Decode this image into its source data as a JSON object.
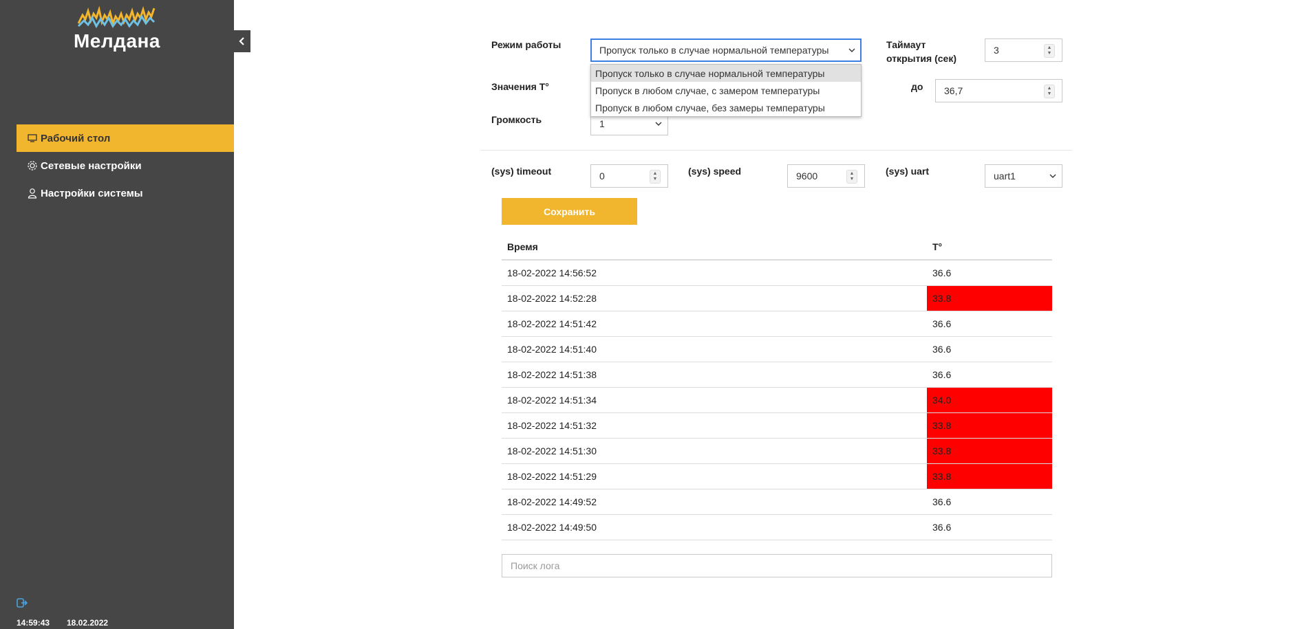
{
  "brand": {
    "name": "Мелдана"
  },
  "sidebar": {
    "items": [
      {
        "label": "Рабочий стол",
        "icon": "monitor-icon",
        "active": true
      },
      {
        "label": "Сетевые настройки",
        "icon": "gear-icon",
        "active": false
      },
      {
        "label": "Настройки системы",
        "icon": "user-icon",
        "active": false
      }
    ],
    "footer": {
      "time": "14:59:43",
      "date": "18.02.2022"
    }
  },
  "settings": {
    "mode": {
      "label": "Режим работы",
      "value": "Пропуск только в случае нормальной температуры",
      "options": [
        "Пропуск только в случае нормальной температуры",
        "Пропуск в любом случае, с замером температуры",
        "Пропуск в любом случае, без замеры температуры"
      ]
    },
    "timeout_open": {
      "label": "Таймаут открытия (сек)",
      "value": "3"
    },
    "temp": {
      "label": "Значения T°",
      "to_label": "до",
      "to_value": "36,7"
    },
    "volume": {
      "label": "Громкость",
      "value": "1"
    },
    "sys_timeout": {
      "label": "(sys) timeout",
      "value": "0"
    },
    "sys_speed": {
      "label": "(sys) speed",
      "value": "9600"
    },
    "sys_uart": {
      "label": "(sys) uart",
      "value": "uart1"
    }
  },
  "save_label": "Сохранить",
  "log": {
    "headers": [
      "Время",
      "T°"
    ],
    "rows": [
      {
        "time": "18-02-2022 14:56:52",
        "t": "36.6",
        "alert": false
      },
      {
        "time": "18-02-2022 14:52:28",
        "t": "33.8",
        "alert": true
      },
      {
        "time": "18-02-2022 14:51:42",
        "t": "36.6",
        "alert": false
      },
      {
        "time": "18-02-2022 14:51:40",
        "t": "36.6",
        "alert": false
      },
      {
        "time": "18-02-2022 14:51:38",
        "t": "36.6",
        "alert": false
      },
      {
        "time": "18-02-2022 14:51:34",
        "t": "34.0",
        "alert": true
      },
      {
        "time": "18-02-2022 14:51:32",
        "t": "33.8",
        "alert": true
      },
      {
        "time": "18-02-2022 14:51:30",
        "t": "33.8",
        "alert": true
      },
      {
        "time": "18-02-2022 14:51:29",
        "t": "33.8",
        "alert": true
      },
      {
        "time": "18-02-2022 14:49:52",
        "t": "36.6",
        "alert": false
      },
      {
        "time": "18-02-2022 14:49:50",
        "t": "36.6",
        "alert": false
      }
    ],
    "search_placeholder": "Поиск лога"
  },
  "colors": {
    "accent": "#f2b52e",
    "sidebar": "#464646",
    "alert": "#ff0000",
    "logo_blue": "#6ec1e4"
  }
}
